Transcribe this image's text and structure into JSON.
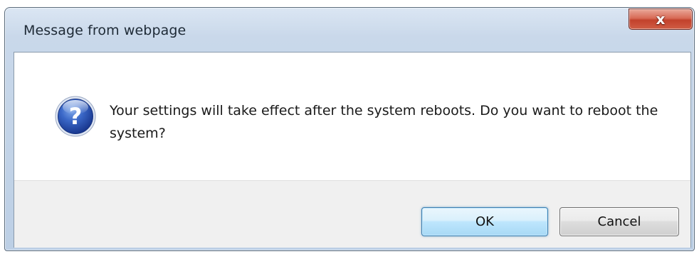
{
  "dialog": {
    "title": "Message from webpage",
    "close_glyph": "x",
    "icon": "question-icon",
    "icon_glyph": "?",
    "message": "Your settings will take effect after the system reboots. Do you want to reboot the system?"
  },
  "buttons": {
    "ok_label": "OK",
    "cancel_label": "Cancel"
  },
  "colors": {
    "icon_blue": "#2a56b8",
    "close_red": "#c7432d",
    "footer_gray": "#f0f0f0",
    "ok_border": "#3c7fb1"
  }
}
